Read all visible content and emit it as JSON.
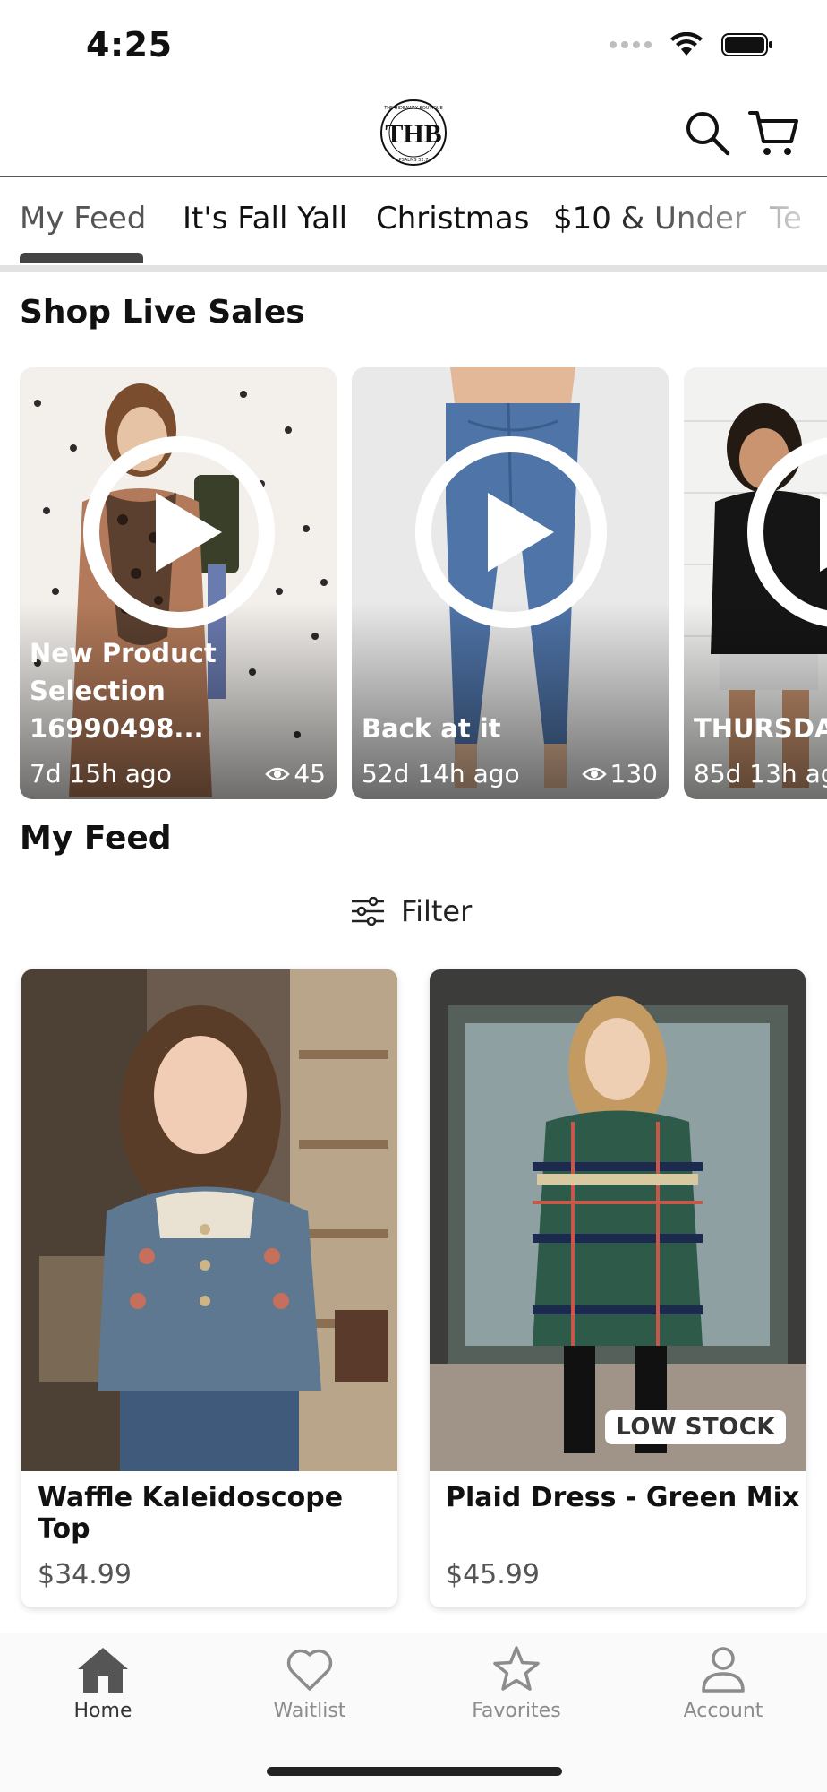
{
  "status_bar": {
    "time": "4:25"
  },
  "header": {
    "logo_text": "THB",
    "logo_ring_top": "THE HIDEAWAY BOUTIQUE",
    "logo_ring_bottom": "PSALMS 32:7"
  },
  "tabs": [
    {
      "label": "My Feed",
      "active": true
    },
    {
      "label": "It's Fall Yall",
      "active": false
    },
    {
      "label": "Christmas",
      "active": false
    },
    {
      "label": "$10 & Under",
      "active": false
    },
    {
      "label": "Te",
      "active": false
    }
  ],
  "live_sales": {
    "title": "Shop Live Sales",
    "items": [
      {
        "title": "New Product Selection 16990498...",
        "time": "7d 15h ago",
        "views": "45",
        "views_icon": "eye-icon"
      },
      {
        "title": "Back at it",
        "time": "52d 14h ago",
        "views": "130",
        "views_icon": "eye-icon"
      },
      {
        "title": "THURSDAY",
        "time": "85d 13h ag",
        "views": "",
        "views_icon": "eye-icon"
      }
    ]
  },
  "feed": {
    "title": "My Feed",
    "filter_label": "Filter",
    "products": [
      {
        "name": "Waffle Kaleidoscope Top",
        "price": "$34.99",
        "badge": ""
      },
      {
        "name": "Plaid Dress - Green Mix",
        "price": "$45.99",
        "badge": "LOW STOCK"
      }
    ]
  },
  "bottom_nav": [
    {
      "label": "Home",
      "icon": "home-icon",
      "active": true
    },
    {
      "label": "Waitlist",
      "icon": "heart-icon",
      "active": false
    },
    {
      "label": "Favorites",
      "icon": "star-icon",
      "active": false
    },
    {
      "label": "Account",
      "icon": "person-icon",
      "active": false
    }
  ],
  "colors": {
    "accent": "#444444",
    "inactive_nav": "#8c8c8c",
    "price": "#555555",
    "divider": "#e2e2e2"
  }
}
